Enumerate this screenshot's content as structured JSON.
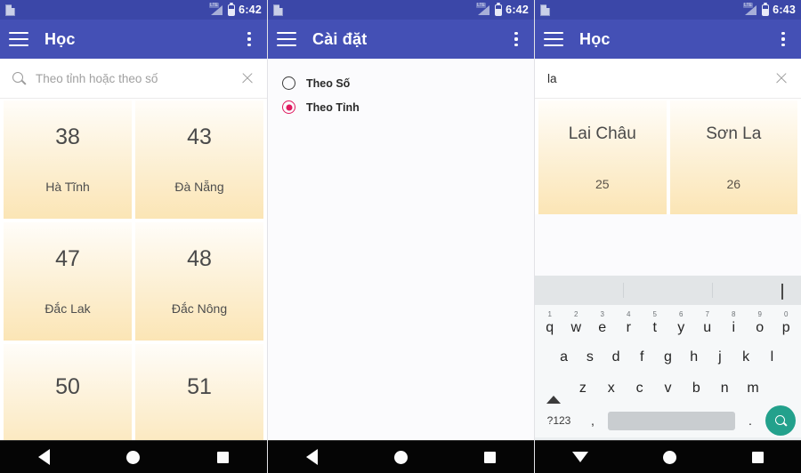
{
  "panels": [
    {
      "id": "learn-list",
      "statusbar": {
        "time": "6:42",
        "notification_icon": "note-icon",
        "signal_icon": "lte-signal-icon",
        "signal_label": "LTE",
        "battery_icon": "battery-icon"
      },
      "appbar": {
        "menu_icon": "hamburger-icon",
        "title": "Học",
        "overflow_icon": "overflow-menu-icon"
      },
      "search": {
        "icon": "search-icon",
        "placeholder": "Theo tỉnh hoặc theo số",
        "value": "",
        "clear_icon": "clear-icon"
      },
      "cards": [
        {
          "number": "38",
          "name": "Hà Tĩnh"
        },
        {
          "number": "43",
          "name": "Đà Nẵng"
        },
        {
          "number": "47",
          "name": "Đắc Lak"
        },
        {
          "number": "48",
          "name": "Đắc Nông"
        },
        {
          "number": "50",
          "name": ""
        },
        {
          "number": "51",
          "name": ""
        }
      ],
      "navbar": {
        "back_icon": "back-triangle-icon",
        "home_icon": "home-circle-icon",
        "recents_icon": "recents-square-icon"
      }
    },
    {
      "id": "settings",
      "statusbar": {
        "time": "6:42",
        "notification_icon": "note-icon",
        "signal_icon": "lte-signal-icon",
        "signal_label": "LTE",
        "battery_icon": "battery-icon"
      },
      "appbar": {
        "menu_icon": "hamburger-icon",
        "title": "Cài đặt",
        "overflow_icon": "overflow-menu-icon"
      },
      "options": [
        {
          "label": "Theo Số",
          "checked": false
        },
        {
          "label": "Theo Tỉnh",
          "checked": true
        }
      ],
      "navbar": {
        "back_icon": "back-triangle-icon",
        "home_icon": "home-circle-icon",
        "recents_icon": "recents-square-icon"
      }
    },
    {
      "id": "search-results",
      "statusbar": {
        "time": "6:43",
        "notification_icon": "note-icon",
        "signal_icon": "lte-signal-icon",
        "signal_label": "LTE",
        "battery_icon": "battery-icon"
      },
      "appbar": {
        "menu_icon": "hamburger-icon",
        "title": "Học",
        "overflow_icon": "overflow-menu-icon"
      },
      "search": {
        "placeholder": "Theo tỉnh hoặc theo số",
        "value": "la",
        "clear_icon": "clear-icon"
      },
      "results": [
        {
          "name": "Lai Châu",
          "number": "25"
        },
        {
          "name": "Sơn La",
          "number": "26"
        }
      ],
      "keyboard": {
        "mic_icon": "microphone-icon",
        "row1": [
          {
            "key": "q",
            "num": "1"
          },
          {
            "key": "w",
            "num": "2"
          },
          {
            "key": "e",
            "num": "3"
          },
          {
            "key": "r",
            "num": "4"
          },
          {
            "key": "t",
            "num": "5"
          },
          {
            "key": "y",
            "num": "6"
          },
          {
            "key": "u",
            "num": "7"
          },
          {
            "key": "i",
            "num": "8"
          },
          {
            "key": "o",
            "num": "9"
          },
          {
            "key": "p",
            "num": "0"
          }
        ],
        "row2": [
          "a",
          "s",
          "d",
          "f",
          "g",
          "h",
          "j",
          "k",
          "l"
        ],
        "row3": [
          "z",
          "x",
          "c",
          "v",
          "b",
          "n",
          "m"
        ],
        "shift_icon": "shift-icon",
        "backspace_icon": "backspace-icon",
        "sym_key": "?123",
        "comma_key": ",",
        "period_key": ".",
        "space_key": "",
        "search_icon": "keyboard-search-icon"
      },
      "navbar": {
        "back_icon": "down-triangle-icon",
        "home_icon": "home-circle-icon",
        "recents_icon": "recents-square-icon"
      }
    }
  ],
  "colors": {
    "appbar": "#4450b5",
    "statusbar": "#3b47a8",
    "card_top": "#fffdf9",
    "card_bottom": "#fbe5b5",
    "radio_checked": "#e0195f",
    "keyboard_search": "#23a18c",
    "navbar": "#050505"
  }
}
